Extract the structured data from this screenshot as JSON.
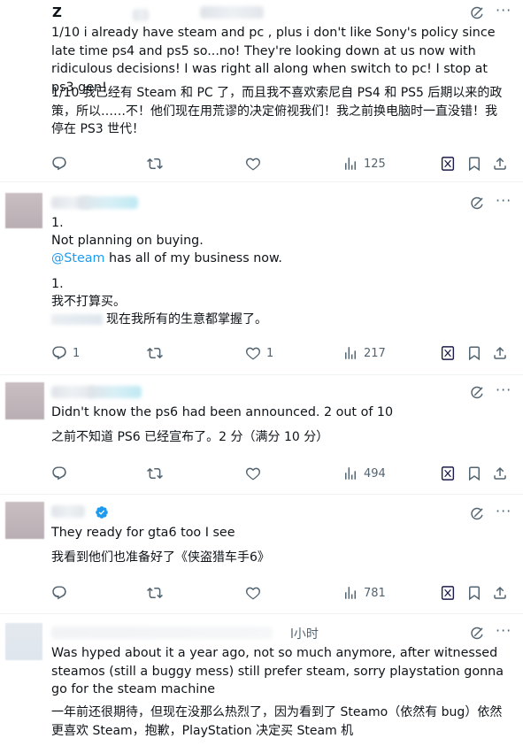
{
  "posts": [
    {
      "user": "Z",
      "time": "",
      "text_en": "1/10 i already have steam and pc , plus i don't like Sony's policy since late time ps4 and ps5 so...no! They're looking down at us now with ridiculous decisions! I was right all along when switch to pc! I stop at ps3 gen!",
      "text_cn": "1/10 我已经有 Steam 和 PC 了，而且我不喜欢索尼自 PS4 和 PS5 后期以来的政策，所以……不！他们现在用荒谬的决定俯视我们！我之前换电脑时一直没错！我停在 PS3 世代！",
      "replies": "",
      "reposts": "",
      "likes": "",
      "views": "125"
    },
    {
      "line1": "1.",
      "line2": "Not planning on buying.",
      "mention": "@Steam",
      "line3": " has all of my business now.",
      "cn1": "1.",
      "cn2": "我不打算买。",
      "cn3": "现在我所有的生意都掌握了。",
      "replies": "1",
      "reposts": "",
      "likes": "1",
      "views": "217"
    },
    {
      "text_en": "Didn't know the ps6 had been announced. 2 out of 10",
      "text_cn": "之前不知道 PS6 已经宣布了。2 分（满分 10 分）",
      "views": "494"
    },
    {
      "text_en": "They ready for gta6 too I see",
      "text_cn": "我看到他们也准备好了《侠盗猎车手6》",
      "views": "781"
    },
    {
      "time": "l小时",
      "text_en": "Was hyped about it a year ago, not so much anymore, after witnessed steamos (still a buggy mess) still prefer steam, sorry playstation gonna go for the steam machine",
      "text_cn": "一年前还很期待，但现在没那么热烈了，因为看到了 Steamo（依然有 bug）依然更喜欢 Steam，抱歉，PlayStation 决定买 Steam 机"
    }
  ],
  "icons": [
    "reply-icon",
    "repost-icon",
    "like-icon",
    "views-icon",
    "grok-icon",
    "bookmark-icon",
    "share-icon",
    "more-icon",
    "verified-icon"
  ],
  "colors": {
    "text": "#0f1419",
    "muted": "#536471",
    "link": "#1d9bf0"
  }
}
